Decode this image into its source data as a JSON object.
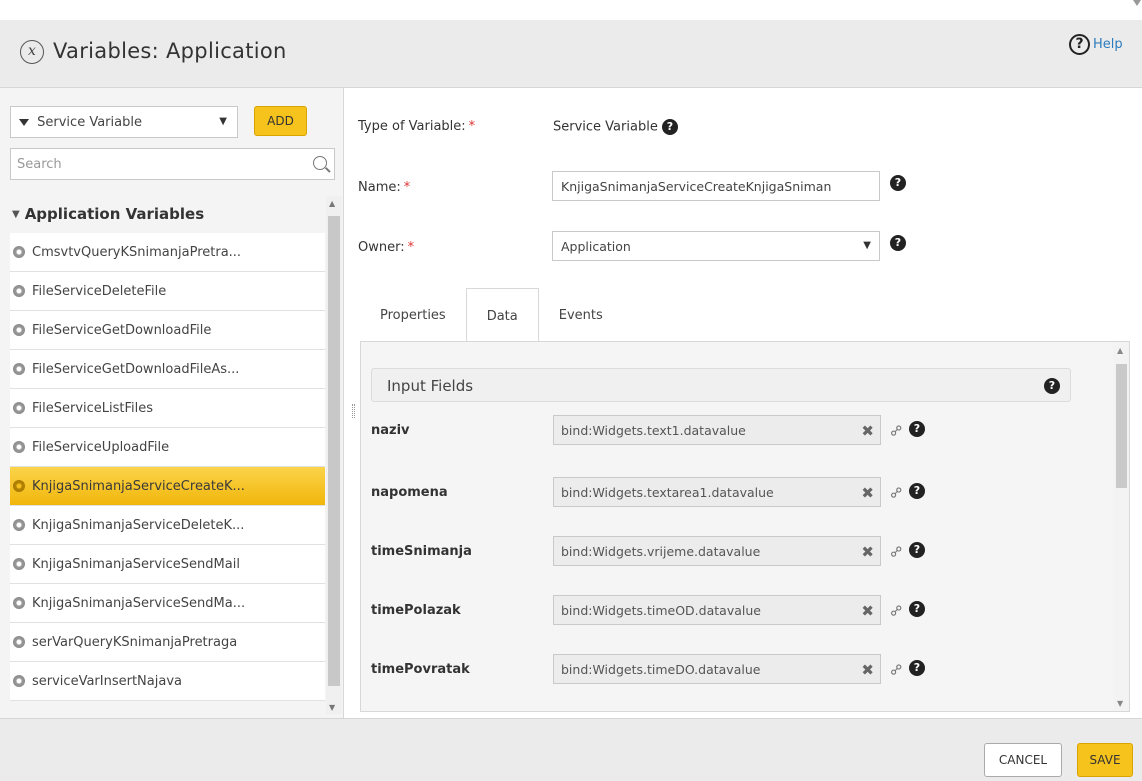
{
  "header": {
    "title": "Variables: Application",
    "close_glyph": "x",
    "help_label": "Help",
    "help_glyph": "?"
  },
  "sidebar": {
    "type_select": {
      "value": "Service Variable"
    },
    "add_label": "ADD",
    "search": {
      "placeholder": "Search"
    },
    "group_title": "Application Variables",
    "items": [
      {
        "label": "CmsvtvQueryKSnimanjaPretra..."
      },
      {
        "label": "FileServiceDeleteFile"
      },
      {
        "label": "FileServiceGetDownloadFile"
      },
      {
        "label": "FileServiceGetDownloadFileAs..."
      },
      {
        "label": "FileServiceListFiles"
      },
      {
        "label": "FileServiceUploadFile"
      },
      {
        "label": "KnjigaSnimanjaServiceCreateK...",
        "selected": true
      },
      {
        "label": "KnjigaSnimanjaServiceDeleteK..."
      },
      {
        "label": "KnjigaSnimanjaServiceSendMail"
      },
      {
        "label": "KnjigaSnimanjaServiceSendMa..."
      },
      {
        "label": "serVarQueryKSnimanjaPretraga"
      },
      {
        "label": "serviceVarInsertNajava"
      }
    ]
  },
  "form": {
    "type_label": "Type of Variable:",
    "type_value": "Service Variable",
    "name_label": "Name:",
    "name_value": "KnjigaSnimanjaServiceCreateKnjigaSniman",
    "owner_label": "Owner:",
    "owner_value": "Application",
    "required_mark": "*",
    "help_glyph": "?"
  },
  "tabs": [
    {
      "label": "Properties"
    },
    {
      "label": "Data",
      "active": true
    },
    {
      "label": "Events"
    }
  ],
  "data_panel": {
    "section_title": "Input Fields",
    "fields": [
      {
        "name": "naziv",
        "value": "bind:Widgets.text1.datavalue"
      },
      {
        "name": "napomena",
        "value": "bind:Widgets.textarea1.datavalue"
      },
      {
        "name": "timeSnimanja",
        "value": "bind:Widgets.vrijeme.datavalue"
      },
      {
        "name": "timePolazak",
        "value": "bind:Widgets.timeOD.datavalue"
      },
      {
        "name": "timePovratak",
        "value": "bind:Widgets.timeDO.datavalue"
      }
    ]
  },
  "footer": {
    "cancel_label": "CANCEL",
    "save_label": "SAVE"
  },
  "colors": {
    "accent": "#f6c21c",
    "help_link": "#2b7bbd",
    "required": "#dd3333"
  },
  "icons": [
    "close-icon",
    "help-icon",
    "filter-icon",
    "chevron-down-icon",
    "search-icon",
    "gear-icon",
    "clear-icon",
    "link-icon"
  ]
}
